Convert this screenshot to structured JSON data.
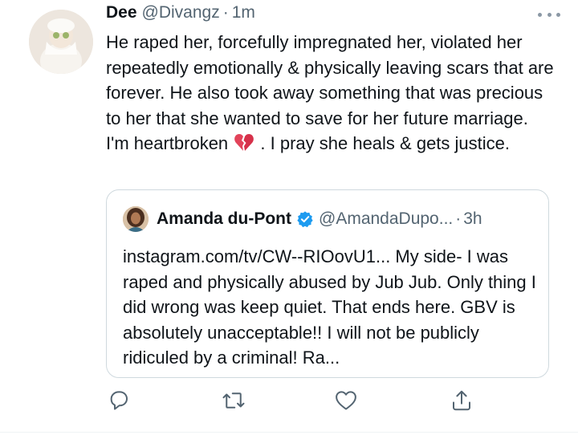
{
  "tweet": {
    "author_name": "Dee",
    "author_handle": "@Divangz",
    "separator": "·",
    "time": "1m",
    "text_before_emoji": "He raped her, forcefully impregnated her, violated her repeatedly emotionally & physically leaving scars that are forever. He also took away something that was precious to her that she wanted to save for her future marriage. I'm heartbroken ",
    "emoji": "broken-heart-emoji",
    "text_after_emoji": " . I pray she heals & gets justice."
  },
  "quoted_tweet": {
    "author_name": "Amanda du-Pont",
    "author_handle": "@AmandaDupo...",
    "separator": "·",
    "time": "3h",
    "verified": true,
    "text": "instagram.com/tv/CW--RIOovU1... My side- I was raped and physically abused by Jub Jub. Only thing I did wrong was keep quiet. That ends here. GBV is absolutely unacceptable!! I will not be publicly ridiculed by a criminal! Ra..."
  },
  "actions": [
    {
      "icon": "reply-icon"
    },
    {
      "icon": "retweet-icon"
    },
    {
      "icon": "like-icon"
    },
    {
      "icon": "share-icon"
    }
  ],
  "colors": {
    "text": "#0f1419",
    "secondary": "#536471",
    "verified": "#1d9bf0",
    "border": "#cfd9de"
  }
}
